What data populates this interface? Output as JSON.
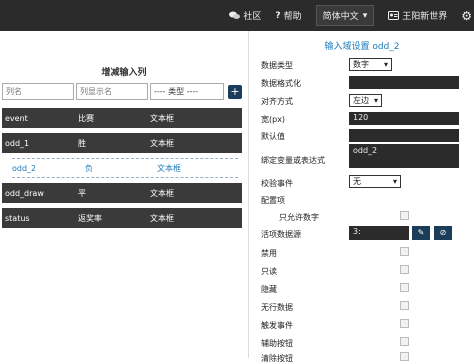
{
  "topbar": {
    "community": "社区",
    "help": "帮助",
    "language": "简体中文",
    "user": "王阳新世界"
  },
  "left": {
    "title": "增减输入列",
    "inputs": {
      "col_name_placeholder": "列名",
      "col_display_placeholder": "列显示名",
      "type_select": "---- 类型 ----",
      "add_label": "+"
    },
    "rows": [
      {
        "name": "event",
        "display": "比赛",
        "type": "文本框",
        "selected": false
      },
      {
        "name": "odd_1",
        "display": "胜",
        "type": "文本框",
        "selected": false
      },
      {
        "name": "odd_2",
        "display": "负",
        "type": "文本框",
        "selected": true
      },
      {
        "name": "odd_draw",
        "display": "平",
        "type": "文本框",
        "selected": false
      },
      {
        "name": "status",
        "display": "返奖率",
        "type": "文本框",
        "selected": false
      }
    ]
  },
  "right": {
    "title": "输入域设置 odd_2",
    "data_type_label": "数据类型",
    "data_type_value": "数字",
    "data_format_label": "数据格式化",
    "data_format_value": "",
    "align_label": "对齐方式",
    "align_value": "左边",
    "width_label": "宽(px)",
    "width_value": "120",
    "default_label": "默认值",
    "default_value": "",
    "bind_label": "绑定变量或表达式",
    "bind_value": "odd_2",
    "verify_label": "校验事件",
    "verify_value": "无",
    "config_label": "配置项",
    "options": [
      {
        "label": "只允许数字"
      },
      {
        "label": "活项数据源"
      },
      {
        "label": "禁用"
      },
      {
        "label": "只读"
      },
      {
        "label": "隐藏"
      },
      {
        "label": "无行数据"
      },
      {
        "label": "触发事件"
      },
      {
        "label": "辅助按钮"
      },
      {
        "label": "清除按钮"
      }
    ],
    "datasource_value": "3:",
    "datasource_edit": "✎",
    "datasource_clear": "⊘"
  }
}
